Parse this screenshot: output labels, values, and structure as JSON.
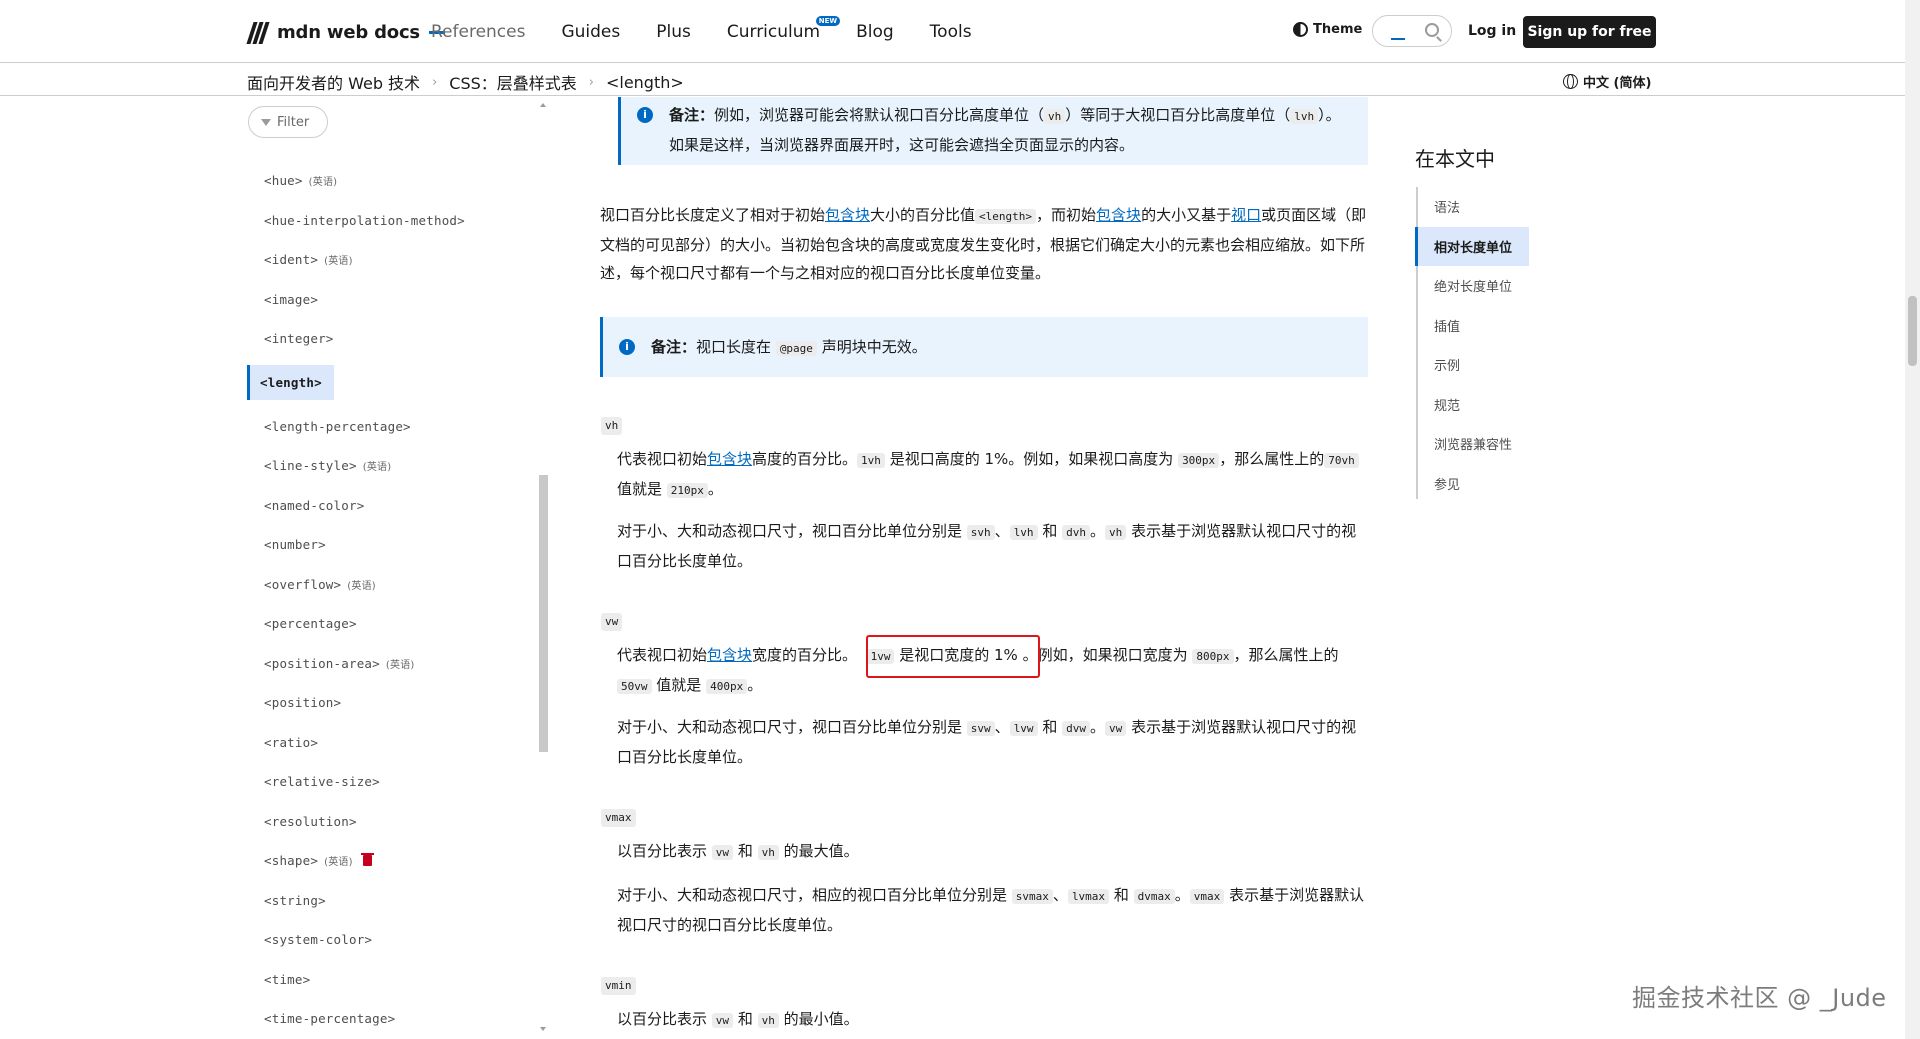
{
  "header": {
    "logo_text": "mdn web docs",
    "nav": [
      {
        "label": "References"
      },
      {
        "label": "Guides"
      },
      {
        "label": "Plus"
      },
      {
        "label": "Curriculum",
        "badge": "NEW"
      },
      {
        "label": "Blog"
      },
      {
        "label": "Tools"
      }
    ],
    "theme_label": "Theme",
    "login_label": "Log in",
    "signup_label": "Sign up for free"
  },
  "breadcrumb": {
    "items": [
      "面向开发者的 Web 技术",
      "CSS：层叠样式表",
      "<length>"
    ],
    "language": "中文 (简体)"
  },
  "sidebar": {
    "filter_placeholder": "Filter",
    "items": [
      {
        "label": "<hue>",
        "note": "(英语)"
      },
      {
        "label": "<hue-interpolation-method>",
        "note": ""
      },
      {
        "label": "<ident>",
        "note": "(英语)"
      },
      {
        "label": "<image>",
        "note": ""
      },
      {
        "label": "<integer>",
        "note": ""
      },
      {
        "label": "<length>",
        "note": "",
        "active": true
      },
      {
        "label": "<length-percentage>",
        "note": ""
      },
      {
        "label": "<line-style>",
        "note": "(英语)"
      },
      {
        "label": "<named-color>",
        "note": ""
      },
      {
        "label": "<number>",
        "note": ""
      },
      {
        "label": "<overflow>",
        "note": "(英语)"
      },
      {
        "label": "<percentage>",
        "note": ""
      },
      {
        "label": "<position-area>",
        "note": "(英语)"
      },
      {
        "label": "<position>",
        "note": ""
      },
      {
        "label": "<ratio>",
        "note": ""
      },
      {
        "label": "<relative-size>",
        "note": ""
      },
      {
        "label": "<resolution>",
        "note": ""
      },
      {
        "label": "<shape>",
        "note": "(英语)",
        "deprecated": true
      },
      {
        "label": "<string>",
        "note": ""
      },
      {
        "label": "<system-color>",
        "note": ""
      },
      {
        "label": "<time>",
        "note": ""
      },
      {
        "label": "<time-percentage>",
        "note": ""
      }
    ]
  },
  "article": {
    "note1": {
      "label": "备注：",
      "t1": "例如，浏览器可能会将默认视口百分比高度单位（",
      "c1": "vh",
      "t2": "）等同于大视口百分比高度单位（",
      "c2": "lvh",
      "t3": "）。如果是这样，当浏览器界面展开时，这可能会遮挡全页面显示的内容。"
    },
    "intro": {
      "t1": "视口百分比长度定义了相对于初始",
      "link1": "包含块",
      "t2": "大小的百分比值",
      "c1": "<length>",
      "t3": "，而初始",
      "link2": "包含块",
      "t4": "的大小又基于",
      "link3": "视口",
      "t5": "或页面区域（即文档的可见部分）的大小。当初始包含块的高度或宽度发生变化时，根据它们确定大小的元素也会相应缩放。如下所述，每个视口尺寸都有一个与之相对应的视口百分比长度单位变量。"
    },
    "note2": {
      "label": "备注：",
      "t1": "视口长度在",
      "c1": "@page",
      "t2": "声明块中无效。"
    },
    "vh": {
      "term": "vh",
      "p1_t1": "代表视口初始",
      "p1_link": "包含块",
      "p1_t2": "高度的百分比。",
      "p1_c1": "1vh",
      "p1_t3": "是视口高度的 1%。例如，如果视口高度为",
      "p1_c2": "300px",
      "p1_t4": "，那么属性上的",
      "p1_c3": "70vh",
      "p1_t5": "值就是",
      "p1_c4": "210px",
      "p1_t6": "。",
      "p2_t1": "对于小、大和动态视口尺寸，视口百分比单位分别是",
      "p2_c1": "svh",
      "p2_t2": "、",
      "p2_c2": "lvh",
      "p2_t3": "和",
      "p2_c3": "dvh",
      "p2_t4": "。",
      "p2_c4": "vh",
      "p2_t5": "表示基于浏览器默认视口尺寸的视口百分比长度单位。"
    },
    "vw": {
      "term": "vw",
      "p1_t1": "代表视口初始",
      "p1_link": "包含块",
      "p1_t2": "宽度的百分比。",
      "p1_c1": "1vw",
      "p1_t3": "是视口宽度的 1%",
      "p1_t3b": "。例如，如果视口宽度为",
      "p1_c2": "800px",
      "p1_t4": "，那么属性上的",
      "p1_c3": "50vw",
      "p1_t5": "值就是",
      "p1_c4": "400px",
      "p1_t6": "。",
      "p2_t1": "对于小、大和动态视口尺寸，视口百分比单位分别是",
      "p2_c1": "svw",
      "p2_t2": "、",
      "p2_c2": "lvw",
      "p2_t3": "和",
      "p2_c3": "dvw",
      "p2_t4": "。",
      "p2_c4": "vw",
      "p2_t5": "表示基于浏览器默认视口尺寸的视口百分比长度单位。"
    },
    "vmax": {
      "term": "vmax",
      "p1_t1": "以百分比表示",
      "p1_c1": "vw",
      "p1_t2": "和",
      "p1_c2": "vh",
      "p1_t3": "的最大值。",
      "p2_t1": "对于小、大和动态视口尺寸，相应的视口百分比单位分别是",
      "p2_c1": "svmax",
      "p2_t2": "、",
      "p2_c2": "lvmax",
      "p2_t3": "和",
      "p2_c3": "dvmax",
      "p2_t4": "。",
      "p2_c4": "vmax",
      "p2_t5": "表示基于浏览器默认视口尺寸的视口百分比长度单位。"
    },
    "vmin": {
      "term": "vmin",
      "p1_t1": "以百分比表示",
      "p1_c1": "vw",
      "p1_t2": "和",
      "p1_c2": "vh",
      "p1_t3": "的最小值。"
    }
  },
  "toc": {
    "title": "在本文中",
    "items": [
      {
        "label": "语法"
      },
      {
        "label": "相对长度单位",
        "active": true
      },
      {
        "label": "绝对长度单位"
      },
      {
        "label": "插值"
      },
      {
        "label": "示例"
      },
      {
        "label": "规范"
      },
      {
        "label": "浏览器兼容性"
      },
      {
        "label": "参见"
      }
    ]
  },
  "watermark": "掘金技术社区 @ _Jude",
  "colors": {
    "accent": "#0069c2",
    "note_bg": "#e8f3fd",
    "highlight_box": "#e0151a",
    "active_bg": "#dbe8fb"
  }
}
